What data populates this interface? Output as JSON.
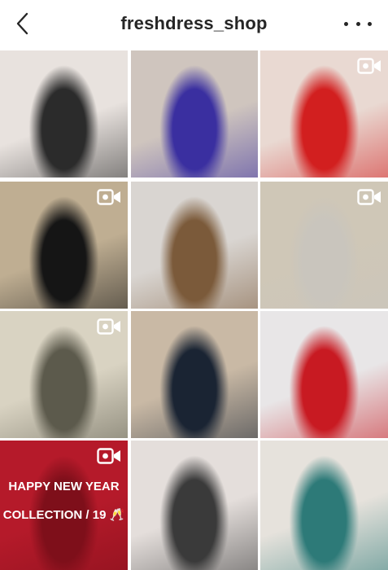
{
  "header": {
    "username": "freshdress_shop",
    "back_icon": "chevron-left-icon",
    "more_icon": "more-horizontal-icon"
  },
  "posts": [
    {
      "id": "post-1",
      "video": false,
      "colors": [
        "#e8e2de",
        "#2b2b2b"
      ]
    },
    {
      "id": "post-2",
      "video": false,
      "colors": [
        "#cfc5be",
        "#3a2fa0"
      ]
    },
    {
      "id": "post-3",
      "video": true,
      "colors": [
        "#e9d9d2",
        "#d21f1f"
      ]
    },
    {
      "id": "post-4",
      "video": true,
      "colors": [
        "#bfae92",
        "#151515"
      ]
    },
    {
      "id": "post-5",
      "video": false,
      "colors": [
        "#d9d5d1",
        "#7b5a3a"
      ]
    },
    {
      "id": "post-6",
      "video": true,
      "colors": [
        "#cfc7b7",
        "#c9c5bd"
      ]
    },
    {
      "id": "post-7",
      "video": true,
      "colors": [
        "#d9d3c2",
        "#5c5a4c"
      ]
    },
    {
      "id": "post-8",
      "video": false,
      "colors": [
        "#c9b9a5",
        "#1a2433"
      ]
    },
    {
      "id": "post-9",
      "video": false,
      "colors": [
        "#e8e6e7",
        "#c81a22"
      ]
    },
    {
      "id": "post-10",
      "video": true,
      "colors": [
        "#b51a2a",
        "#7e0f1a"
      ],
      "caption_line1": "HAPPY NEW YEAR",
      "caption_line2": "COLLECTION / 19 🥂"
    },
    {
      "id": "post-11",
      "video": false,
      "colors": [
        "#e4dedb",
        "#3a3a3a"
      ]
    },
    {
      "id": "post-12",
      "video": false,
      "colors": [
        "#e6e2dc",
        "#2d7a78"
      ]
    }
  ],
  "colors": {
    "text": "#262626",
    "background": "#ffffff",
    "badge": "#ffffff"
  }
}
